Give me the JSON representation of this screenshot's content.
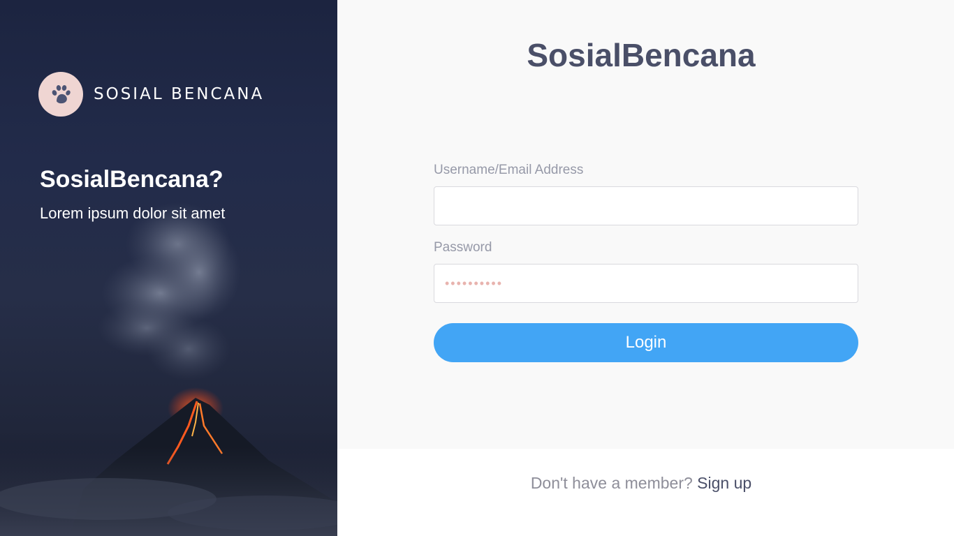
{
  "brand": {
    "name": "SOSIAL BENCANA",
    "logo_icon": "paw-icon"
  },
  "hero": {
    "title": "SosialBencana?",
    "subtitle": "Lorem ipsum dolor sit amet",
    "image": "volcano-eruption-night"
  },
  "login_form": {
    "title": "SosialBencana",
    "username_label": "Username/Email Address",
    "username_value": "",
    "password_label": "Password",
    "password_placeholder": "••••••••••",
    "login_button_label": "Login"
  },
  "footer": {
    "prompt_text": "Don't have a member?",
    "signup_label": "Sign up"
  },
  "colors": {
    "accent_button": "#42a5f5",
    "title_text": "#4a4f68",
    "logo_bg": "#efd5d2",
    "hero_bg": "#222b4a"
  }
}
